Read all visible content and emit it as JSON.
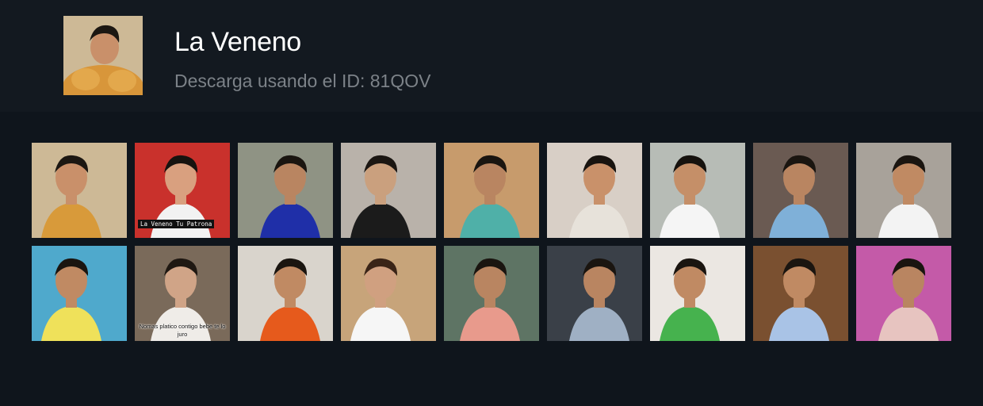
{
  "profile": {
    "name": "La Veneno",
    "subtitle": "Descarga usando el ID: 81QOV"
  },
  "thumbnails": [
    {
      "bg": "#cdb996",
      "accent": "#d89a3a",
      "skin": "#c9906a",
      "hair": "#1c1712",
      "caption": ""
    },
    {
      "bg": "#c9312c",
      "accent": "#f2f2f2",
      "skin": "#d9a07f",
      "hair": "#17130f",
      "caption": "La Veneno Tu Patrona"
    },
    {
      "bg": "#8f9384",
      "accent": "#1f2fa8",
      "skin": "#b98561",
      "hair": "#1a1510",
      "caption": ""
    },
    {
      "bg": "#b9b2aa",
      "accent": "#1b1b1b",
      "skin": "#caa07e",
      "hair": "#1b1612",
      "caption": ""
    },
    {
      "bg": "#c79b6c",
      "accent": "#4fb0a8",
      "skin": "#b98561",
      "hair": "#1a1510",
      "caption": ""
    },
    {
      "bg": "#d8cfc6",
      "accent": "#e7e2da",
      "skin": "#c9916a",
      "hair": "#18130f",
      "caption": ""
    },
    {
      "bg": "#b7bcb6",
      "accent": "#f5f5f5",
      "skin": "#c58f68",
      "hair": "#16120e",
      "caption": ""
    },
    {
      "bg": "#6a5a52",
      "accent": "#7fb0d8",
      "skin": "#b98561",
      "hair": "#1a1510",
      "caption": ""
    },
    {
      "bg": "#a8a29a",
      "accent": "#f3f3f3",
      "skin": "#c08a63",
      "hair": "#1a1510",
      "caption": ""
    },
    {
      "bg": "#4fa9cc",
      "accent": "#efe15a",
      "skin": "#c08a63",
      "hair": "#1a1510",
      "caption": ""
    },
    {
      "bg": "#7a6a5a",
      "accent": "#efece8",
      "skin": "#d0a487",
      "hair": "#1f1812",
      "caption": "Nomas platico contigo bebe te lo juro"
    },
    {
      "bg": "#d9d4cc",
      "accent": "#e65a1c",
      "skin": "#c08a63",
      "hair": "#1a1510",
      "caption": ""
    },
    {
      "bg": "#c7a47a",
      "accent": "#f6f6f6",
      "skin": "#d0a080",
      "hair": "#3a2417",
      "caption": ""
    },
    {
      "bg": "#5e7464",
      "accent": "#e89a8c",
      "skin": "#b98561",
      "hair": "#1a1510",
      "caption": ""
    },
    {
      "bg": "#3a4048",
      "accent": "#9fb0c4",
      "skin": "#b98561",
      "hair": "#1a1510",
      "caption": ""
    },
    {
      "bg": "#ebe7e2",
      "accent": "#46b24e",
      "skin": "#c08a63",
      "hair": "#1a1510",
      "caption": ""
    },
    {
      "bg": "#7a5030",
      "accent": "#a9c3e6",
      "skin": "#c08a63",
      "hair": "#1a1510",
      "caption": ""
    },
    {
      "bg": "#c45aa8",
      "accent": "#e7c4c0",
      "skin": "#b98561",
      "hair": "#1a1510",
      "caption": ""
    }
  ]
}
